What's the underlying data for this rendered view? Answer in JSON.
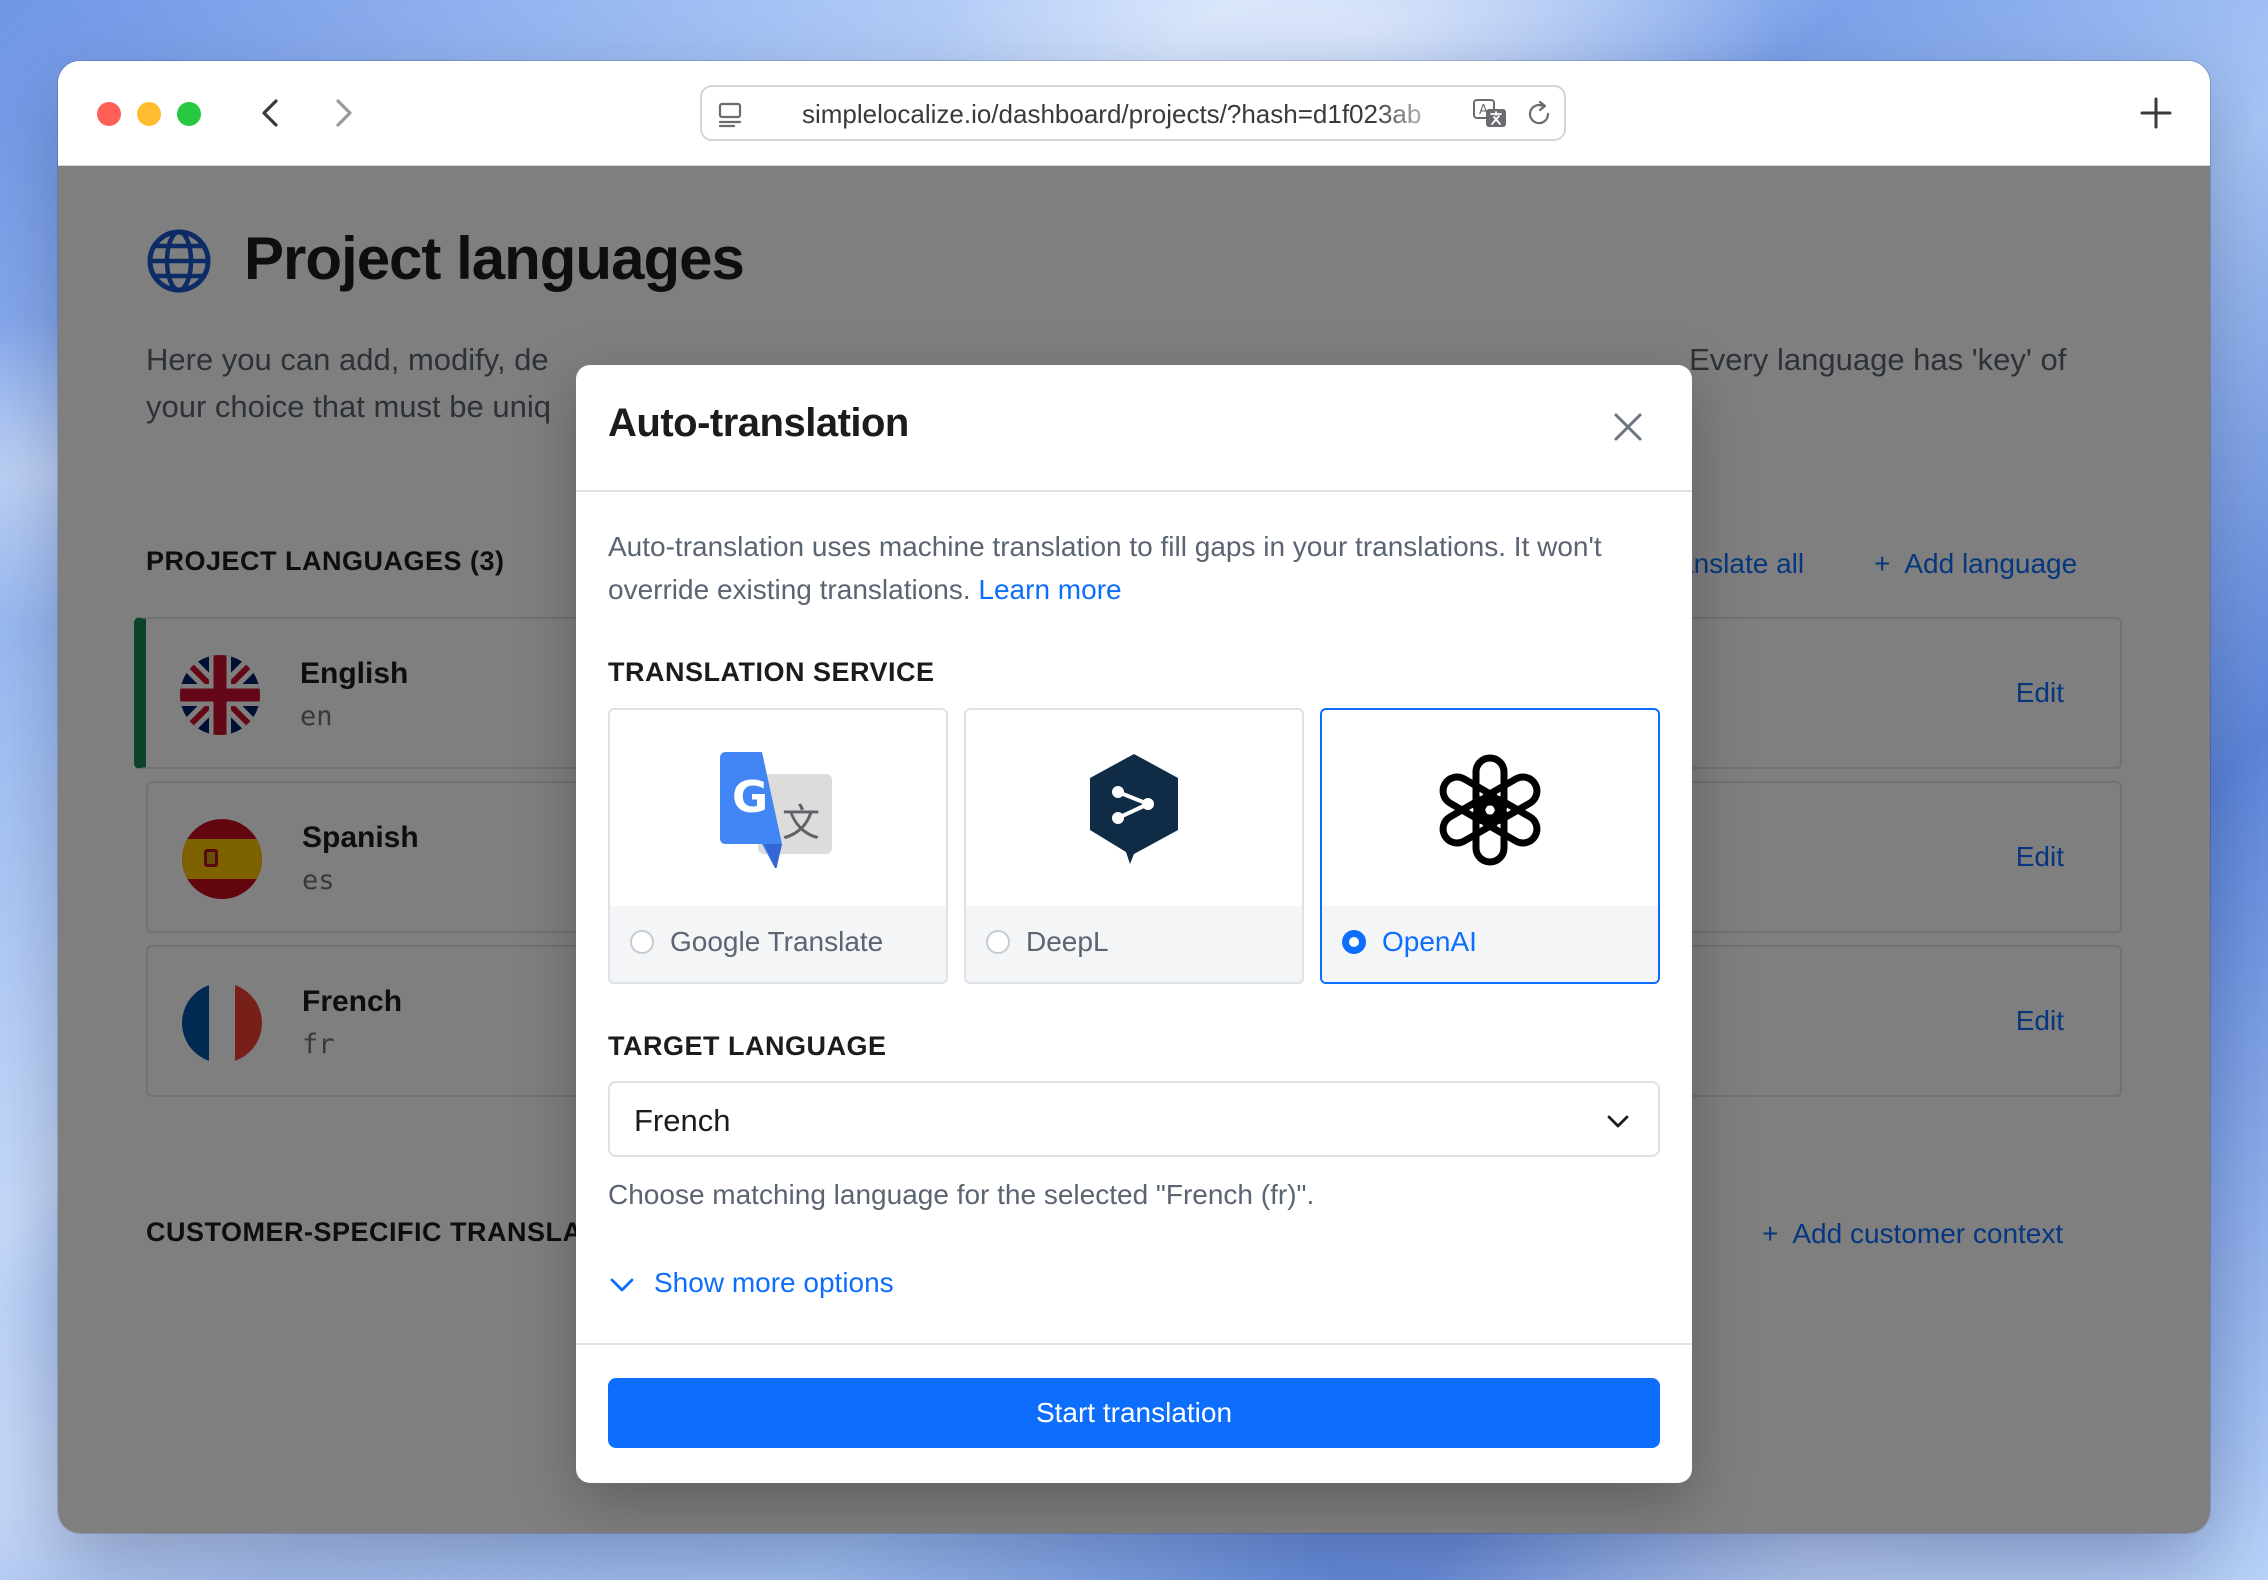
{
  "browser": {
    "url": "simplelocalize.io/dashboard/projects/?hash=d1f023ab"
  },
  "page": {
    "title": "Project languages",
    "description": "Here you can add, modify, de… . Every language has 'key' of your choice that must be uniq…",
    "description_left": "Here you can add, modify, de",
    "description_right": ". Every language has 'key' of",
    "description_line2": "your choice that must be uniq",
    "languages_section_title": "PROJECT LANGUAGES (3)",
    "translate_all_label": "anslate all",
    "add_language_label": "Add language",
    "customer_section_title": "CUSTOMER-SPECIFIC TRANSLA",
    "add_customer_context_label": "Add customer context",
    "languages": [
      {
        "name": "English",
        "key": "en",
        "edit_label": "Edit",
        "active": true,
        "flag": "gb-flag"
      },
      {
        "name": "Spanish",
        "key": "es",
        "edit_label": "Edit",
        "active": false,
        "flag": "es-flag"
      },
      {
        "name": "French",
        "key": "fr",
        "edit_label": "Edit",
        "active": false,
        "flag": "fr-flag"
      }
    ]
  },
  "modal": {
    "title": "Auto-translation",
    "intro_text": "Auto-translation uses machine translation to fill gaps in your translations. It won't override existing translations.",
    "learn_more_label": "Learn more",
    "service_label": "TRANSLATION SERVICE",
    "services": [
      {
        "name": "Google Translate",
        "selected": false,
        "icon": "google-translate-icon"
      },
      {
        "name": "DeepL",
        "selected": false,
        "icon": "deepl-icon"
      },
      {
        "name": "OpenAI",
        "selected": true,
        "icon": "openai-icon"
      }
    ],
    "target_label": "TARGET LANGUAGE",
    "target_value": "French",
    "target_help": "Choose matching language for the selected \"French (fr)\".",
    "show_more_label": "Show more options",
    "start_button_label": "Start translation"
  },
  "colors": {
    "accent": "#0d6efd",
    "active_language_marker": "#198754",
    "overlay": "rgba(0,0,0,0.5)"
  }
}
